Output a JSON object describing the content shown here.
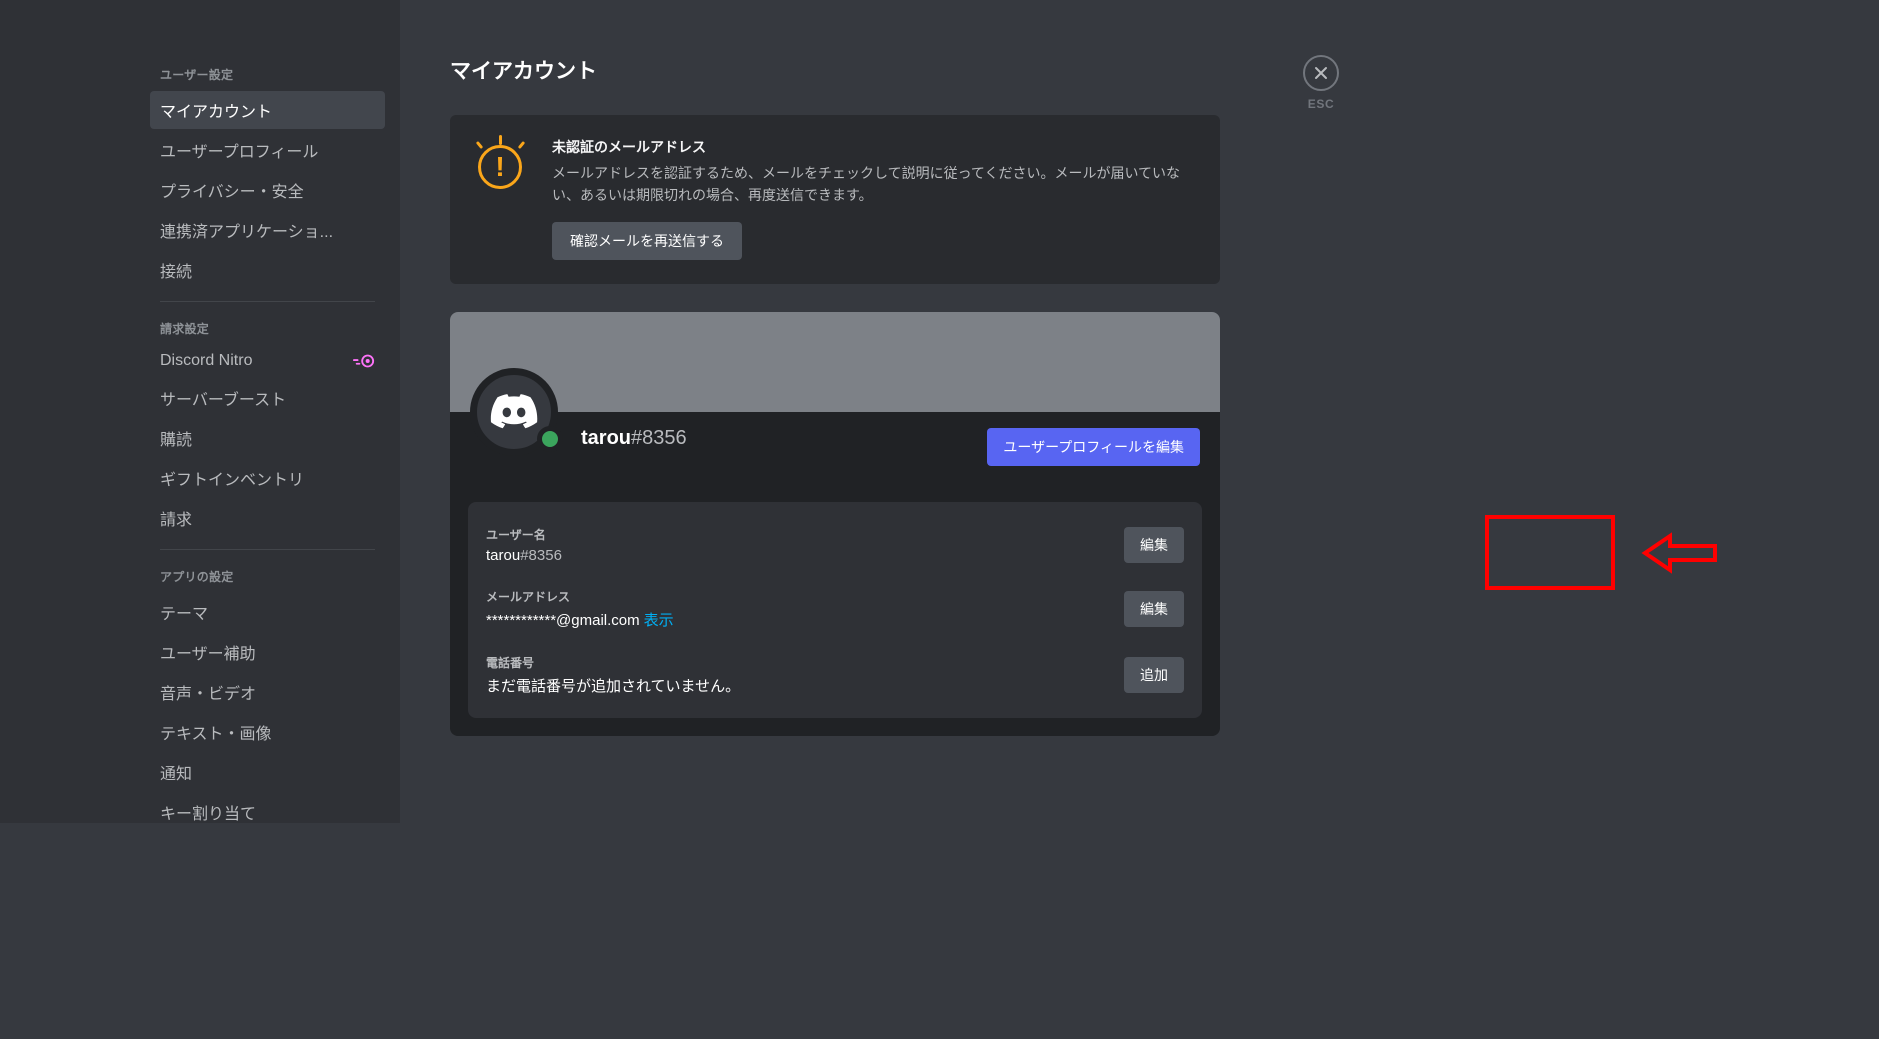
{
  "sidebar": {
    "section_user": "ユーザー設定",
    "items_user": [
      "マイアカウント",
      "ユーザープロフィール",
      "プライバシー・安全",
      "連携済アプリケーショ...",
      "接続"
    ],
    "section_billing": "請求設定",
    "items_billing": [
      "Discord Nitro",
      "サーバーブースト",
      "購読",
      "ギフトインベントリ",
      "請求"
    ],
    "section_app": "アプリの設定",
    "items_app": [
      "テーマ",
      "ユーザー補助",
      "音声・ビデオ",
      "テキスト・画像",
      "通知",
      "キー割り当て"
    ]
  },
  "page": {
    "title": "マイアカウント"
  },
  "notice": {
    "title": "未認証のメールアドレス",
    "text": "メールアドレスを認証するため、メールをチェックして説明に従ってください。メールが届いていない、あるいは期限切れの場合、再度送信できます。",
    "button": "確認メールを再送信する"
  },
  "profile": {
    "name": "tarou",
    "discriminator": "#8356",
    "edit_button": "ユーザープロフィールを編集"
  },
  "fields": {
    "username_label": "ユーザー名",
    "username_value": "tarou",
    "username_discrim": "#8356",
    "email_label": "メールアドレス",
    "email_value": "************@gmail.com",
    "email_reveal": "表示",
    "phone_label": "電話番号",
    "phone_value": "まだ電話番号が追加されていません。",
    "edit_button": "編集",
    "add_button": "追加"
  },
  "close": {
    "label": "ESC"
  }
}
